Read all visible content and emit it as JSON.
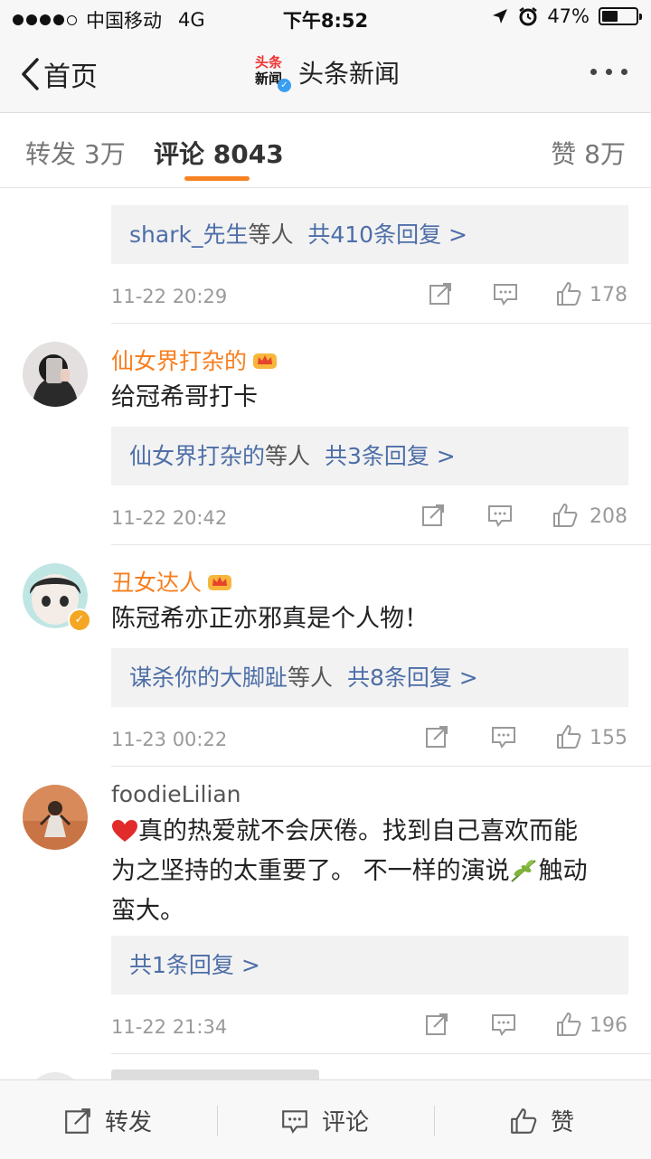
{
  "status_bar": {
    "carrier": "中国移动",
    "network": "4G",
    "time": "下午8:52",
    "battery": "47%",
    "battery_level": 0.47
  },
  "nav": {
    "back_label": "首页",
    "title": "头条新闻",
    "logo_top": "头条",
    "logo_bottom": "新闻"
  },
  "tabs": {
    "repost": "转发 3万",
    "comment": "评论 8043",
    "like": "赞 8万"
  },
  "comments": [
    {
      "reply_names": "shark_先生",
      "reply_suffix": "等人",
      "reply_count": "共410条回复 >",
      "time": "11-22 20:29",
      "likes": "178"
    },
    {
      "username": "仙女界打杂的",
      "text": "给冠希哥打卡",
      "reply_names": "仙女界打杂的",
      "reply_suffix": "等人",
      "reply_count": "共3条回复 >",
      "time": "11-22 20:42",
      "likes": "208"
    },
    {
      "username": "丑女达人",
      "text": "陈冠希亦正亦邪真是个人物！",
      "reply_names": "谋杀你的大脚趾",
      "reply_suffix": "等人",
      "reply_count": "共8条回复 >",
      "time": "11-23 00:22",
      "likes": "155"
    },
    {
      "username": "foodieLilian",
      "text_line1": "真的热爱就不会厌倦。找到自己喜欢而能",
      "text_line2": "为之坚持的太重要了。 不一样的演说",
      "text_line2_end": "触动",
      "text_line3": "蛮大。",
      "reply_count": "共1条回复 >",
      "time": "11-22 21:34",
      "likes": "196"
    }
  ],
  "bottom_bar": {
    "repost": "转发",
    "comment": "评论",
    "like": "赞"
  },
  "colors": {
    "accent_orange": "#f78222",
    "link_blue": "#4d6ea8",
    "username_orange": "#f77e1e"
  }
}
